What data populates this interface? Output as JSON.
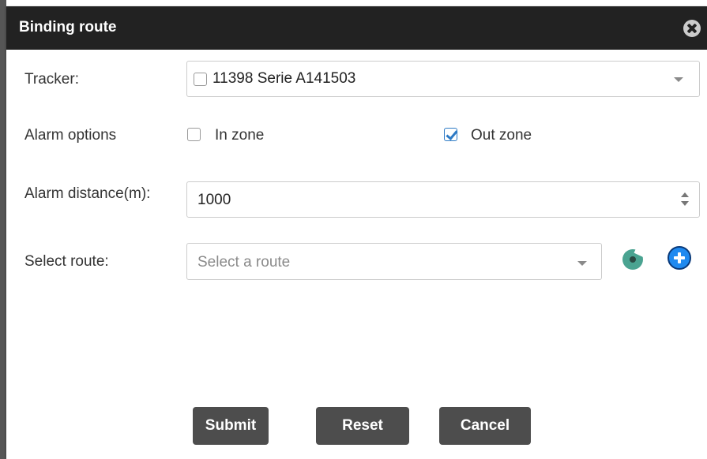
{
  "dialog": {
    "title": "Binding route"
  },
  "tracker": {
    "label": "Tracker:",
    "value": "11398 Serie A141503",
    "checked": false
  },
  "alarm_options": {
    "label": "Alarm options",
    "in_zone": {
      "label": "In zone",
      "checked": false
    },
    "out_zone": {
      "label": "Out zone",
      "checked": true
    }
  },
  "alarm_distance": {
    "label": "Alarm distance(m):",
    "value": "1000"
  },
  "route": {
    "label": "Select route:",
    "placeholder": "Select a route"
  },
  "buttons": {
    "submit": "Submit",
    "reset": "Reset",
    "cancel": "Cancel"
  },
  "colors": {
    "titlebar": "#222222",
    "button": "#4d4d4d",
    "checkbox_accent": "#2d7ac5",
    "route_icon": "#4aa391",
    "add_icon": "#1f8af0"
  },
  "icons": {
    "close": "close-icon",
    "tracker_checkbox": "checkbox-icon",
    "route_preview": "route-preview-icon",
    "add_route": "plus-icon"
  }
}
